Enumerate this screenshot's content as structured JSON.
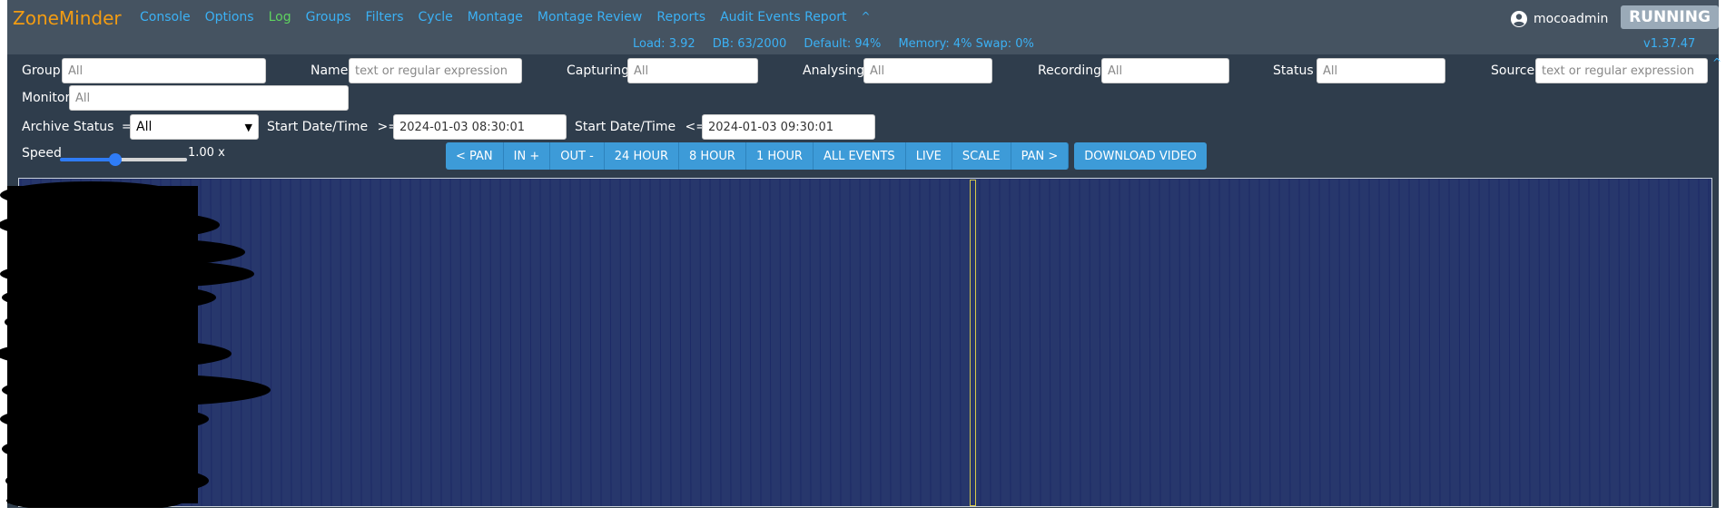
{
  "brand": "ZoneMinder",
  "nav": [
    {
      "label": "Console"
    },
    {
      "label": "Options"
    },
    {
      "label": "Log",
      "active": true
    },
    {
      "label": "Groups"
    },
    {
      "label": "Filters"
    },
    {
      "label": "Cycle"
    },
    {
      "label": "Montage"
    },
    {
      "label": "Montage Review"
    },
    {
      "label": "Reports"
    },
    {
      "label": "Audit Events Report"
    }
  ],
  "nav_caret": "^",
  "user": {
    "name": "mocoadmin",
    "icon": "user-circle-icon"
  },
  "state": "RUNNING",
  "status": {
    "load": "Load: 3.92",
    "db": "DB: 63/2000",
    "default": "Default: 94%",
    "memory": "Memory: 4% Swap: 0%"
  },
  "version": "v1.37.47",
  "filters": {
    "group": {
      "label": "Group",
      "placeholder": "All"
    },
    "name": {
      "label": "Name",
      "placeholder": "text or regular expression"
    },
    "capturing": {
      "label": "Capturing",
      "placeholder": "All"
    },
    "analysing": {
      "label": "Analysing",
      "placeholder": "All"
    },
    "recording": {
      "label": "Recording",
      "placeholder": "All"
    },
    "status": {
      "label": "Status",
      "placeholder": "All"
    },
    "source": {
      "label": "Source",
      "placeholder": "text or regular expression"
    },
    "monitor": {
      "label": "Monitor",
      "placeholder": "All"
    },
    "archive": {
      "label": "Archive Status",
      "op": "=",
      "value": "All"
    },
    "start_from": {
      "label": "Start Date/Time",
      "op": ">=",
      "value": "2024-01-03 08:30:01"
    },
    "start_to": {
      "label": "Start Date/Time",
      "op": "<=",
      "value": "2024-01-03 09:30:01"
    },
    "speed": {
      "label": "Speed",
      "value_text": "1.00 x",
      "value": 1.0
    }
  },
  "buttons": [
    "< PAN",
    "IN +",
    "OUT -",
    "24 HOUR",
    "8 HOUR",
    "1 HOUR",
    "ALL EVENTS",
    "LIVE",
    "SCALE",
    "PAN >"
  ],
  "download": "DOWNLOAD VIDEO",
  "colors": {
    "brand": "#f39c12",
    "link": "#3bb1f5",
    "active_link": "#5fd35f",
    "button": "#3d9bd8",
    "timeline_bg": "#27376c",
    "cursor": "#d6c94a"
  }
}
